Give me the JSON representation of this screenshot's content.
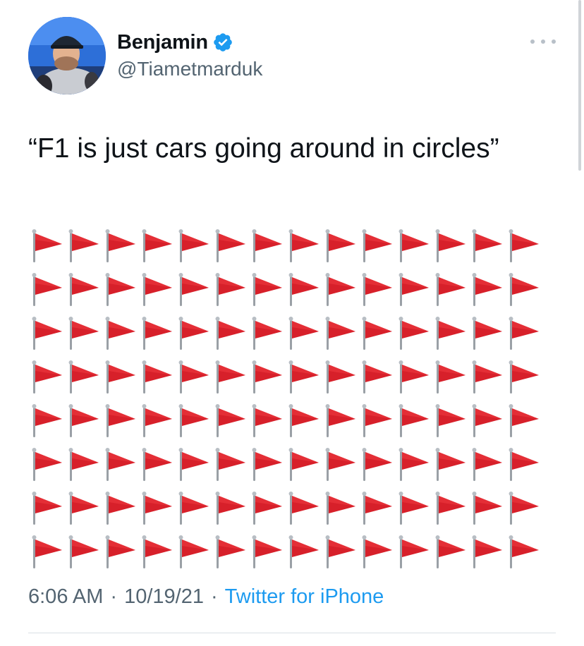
{
  "author": {
    "display_name": "Benjamin",
    "handle": "@Tiametmarduk",
    "verified": true,
    "avatar_icon": "profile-photo-person-in-cap"
  },
  "tweet": {
    "text": "“F1 is just cars going around in circles”",
    "flag_emoji": "🚩",
    "flag_rows": 8,
    "flags_per_row": 14
  },
  "meta": {
    "time": "6:06 AM",
    "separator": "·",
    "date": "10/19/21",
    "source": "Twitter for iPhone"
  },
  "icons": {
    "more": "more-options-icon",
    "verified": "verified-badge-icon",
    "flag": "triangular-red-flag-icon"
  },
  "colors": {
    "text_primary": "#0f1419",
    "text_secondary": "#536471",
    "link": "#1d9bf0",
    "verified_badge": "#1d9bf0",
    "flag_red": "#d7202a",
    "divider": "#d9dfe4"
  }
}
